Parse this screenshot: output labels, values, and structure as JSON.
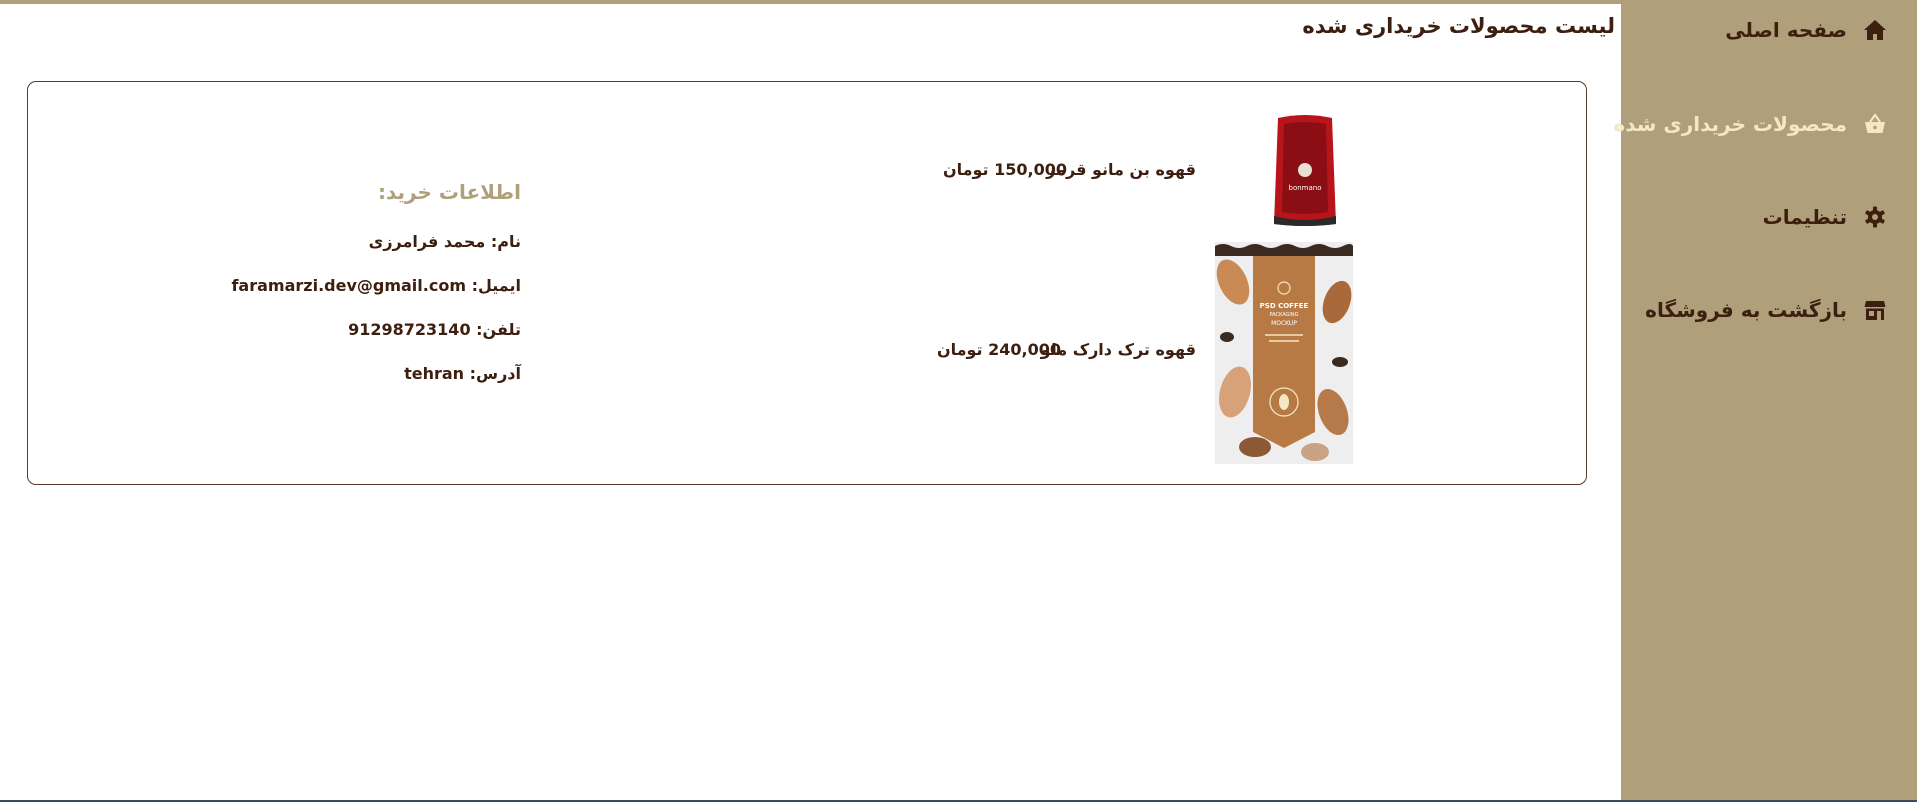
{
  "sidebar": {
    "items": [
      {
        "label": "صفحه اصلی",
        "icon": "home-icon"
      },
      {
        "label": "محصولات خریداری شده",
        "icon": "basket-icon",
        "active": true
      },
      {
        "label": "تنظیمات",
        "icon": "gear-icon"
      },
      {
        "label": "بازگشت به فروشگاه",
        "icon": "store-icon"
      }
    ]
  },
  "main": {
    "title": "لیست محصولات خریداری شده",
    "products": [
      {
        "name": "قهوه بن مانو قرمز",
        "price": "150,000 تومان"
      },
      {
        "name": "قهوه ترک دارک ملو",
        "price": "240,000 تومان"
      }
    ],
    "purchase_info": {
      "title": "اطلاعات خرید:",
      "name": "نام: محمد فرامرزی",
      "email": "ایمیل: faramarzi.dev@gmail.com",
      "phone": "تلفن: 91298723140",
      "address": "آدرس: tehran"
    },
    "product_images": [
      {
        "label": "bonmano"
      },
      {
        "label": "PSD COFFEE",
        "sub": "PACKAGING",
        "tag": "MOCKUP"
      }
    ]
  },
  "colors": {
    "sidebar": "#b09f7b",
    "text": "#3d1f10",
    "active": "#f4e8c4",
    "border": "#5a3a2a"
  }
}
